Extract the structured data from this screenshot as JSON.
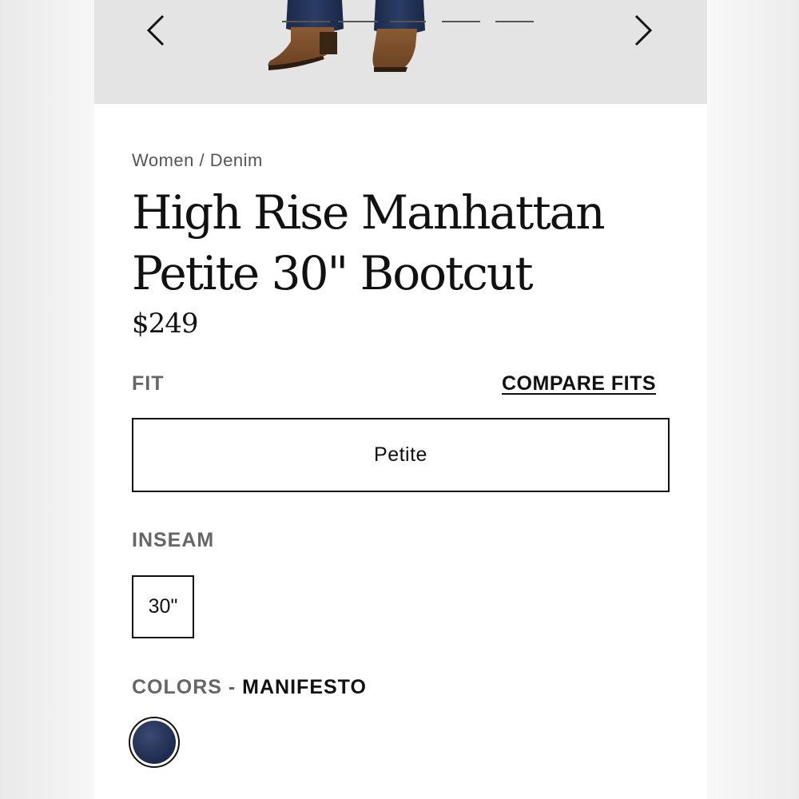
{
  "breadcrumb": "Women / Denim",
  "product": {
    "title_line1": "High Rise Manhattan",
    "title_line2": "Petite 30\" Bootcut",
    "price": "$249"
  },
  "fit": {
    "label": "FIT",
    "compare_link": "COMPARE FITS",
    "selected_option": "Petite"
  },
  "inseam": {
    "label": "INSEAM",
    "selected_option": "30\""
  },
  "colors": {
    "label": "COLORS",
    "separator": " - ",
    "selected": "MANIFESTO",
    "swatch_color": "#1d2b4d"
  },
  "gallery": {
    "prev_icon": "chevron-left-icon",
    "next_icon": "chevron-right-icon",
    "slide_count": 5
  }
}
